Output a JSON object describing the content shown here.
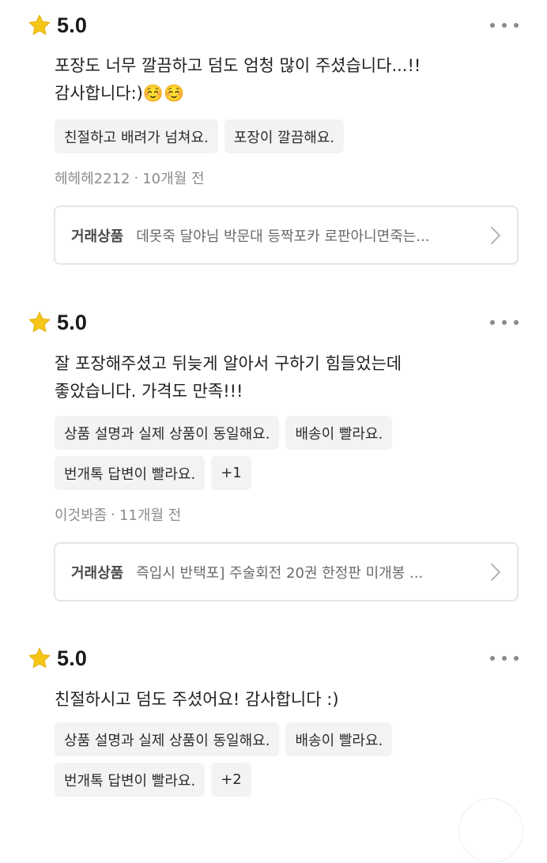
{
  "reviews": [
    {
      "rating": "5.0",
      "text": "포장도 너무 깔끔하고 덤도 엄청 많이 주셨습니다...!!\n감사합니다:)☺️☺️",
      "tags": [
        "친절하고 배려가 넘쳐요.",
        "포장이 깔끔해요."
      ],
      "author": "헤헤헤2212",
      "separator": "·",
      "time": "10개월 전",
      "product_label": "거래상품",
      "product_name": "데못죽 달야님 박문대 등짝포카 로판아니면죽는..."
    },
    {
      "rating": "5.0",
      "text": "잘 포장해주셨고 뒤늦게 알아서 구하기 힘들었는데\n좋았습니다. 가격도 만족!!!",
      "tags": [
        "상품 설명과 실제 상품이 동일해요.",
        "배송이 빨라요.",
        "번개톡 답변이 빨라요.",
        "+1"
      ],
      "author": "이것봐좀",
      "separator": "·",
      "time": "11개월 전",
      "product_label": "거래상품",
      "product_name": "즉입시 반택포] 주술회전 20권 한정판 미개봉 ..."
    },
    {
      "rating": "5.0",
      "text": "친절하시고 덤도 주셨어요! 감사합니다 :)",
      "tags": [
        "상품 설명과 실제 상품이 동일해요.",
        "배송이 빨라요.",
        "번개톡 답변이 빨라요.",
        "+2"
      ]
    }
  ],
  "colors": {
    "star": "#f5c518",
    "tag_bg": "#f3f3f3",
    "meta": "#8c8c8c",
    "border": "#e5e5e5"
  }
}
